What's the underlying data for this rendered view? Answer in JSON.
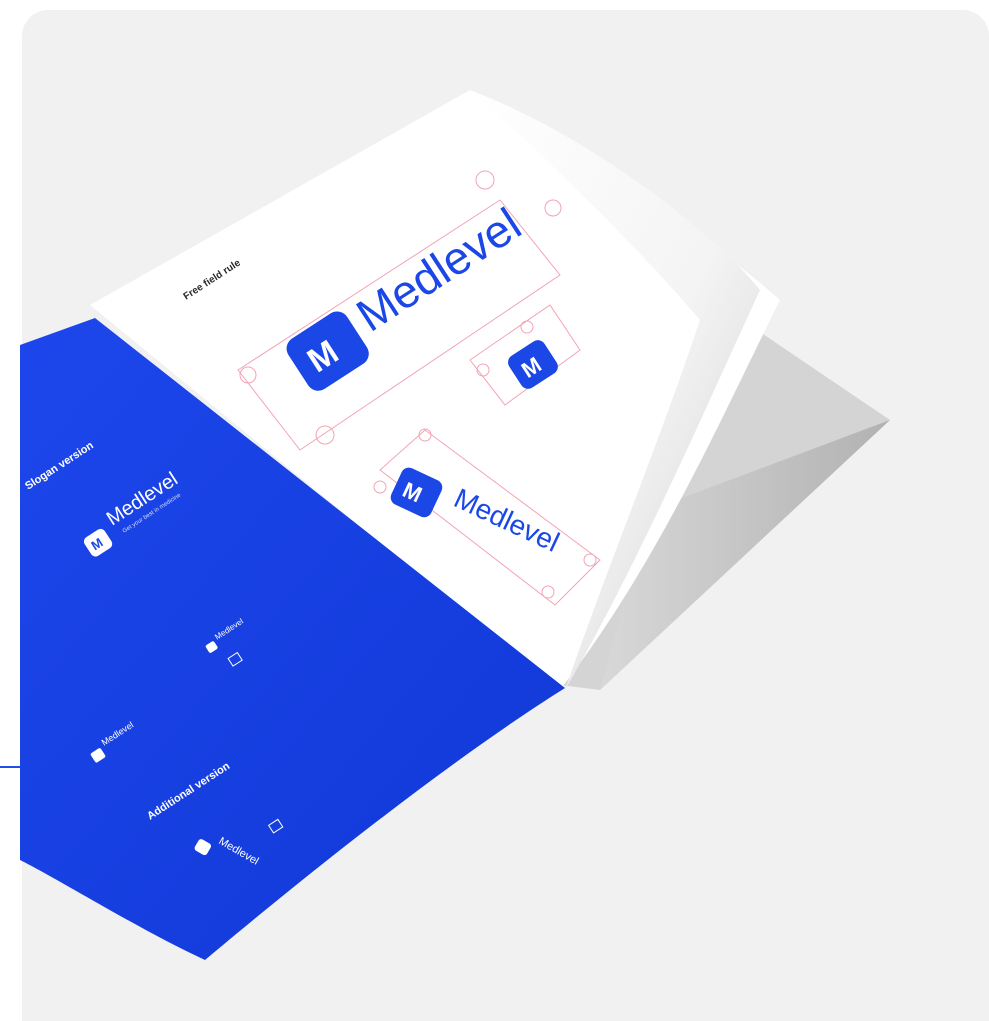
{
  "brand": {
    "name": "Medlevel",
    "slogan": "Get your best in medicine"
  },
  "page_right": {
    "heading": "Free field rule"
  },
  "page_left": {
    "slogan_heading": "Slogan version",
    "additional_heading": "Additional version"
  },
  "colors": {
    "brand_blue": "#1a47e6",
    "paper": "#ffffff",
    "background": "#f1f1f2",
    "guide_pink": "#f2a3b4"
  }
}
